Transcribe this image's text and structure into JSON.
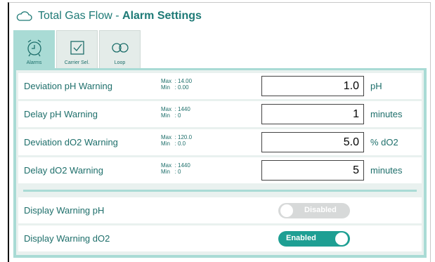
{
  "header": {
    "title_prefix": "Total Gas Flow - ",
    "title_bold": "Alarm Settings",
    "icon": "cloud-icon"
  },
  "tabs": [
    {
      "label": "Alarms",
      "icon": "alarm-clock-icon",
      "active": true
    },
    {
      "label": "Carrier Sel.",
      "icon": "checkbox-icon",
      "active": false
    },
    {
      "label": "Loop",
      "icon": "loop-icon",
      "active": false
    }
  ],
  "settings": [
    {
      "label": "Deviation pH Warning",
      "max_label": "Max",
      "max": ": 14.00",
      "min_label": "Min",
      "min": ": 0.00",
      "value": "1.0",
      "unit": "pH"
    },
    {
      "label": "Delay pH Warning",
      "max_label": "Max",
      "max": ": 1440",
      "min_label": "Min",
      "min": ": 0",
      "value": "1",
      "unit": "minutes"
    },
    {
      "label": "Deviation dO2 Warning",
      "max_label": "Max",
      "max": ": 120.0",
      "min_label": "Min",
      "min": ": 0.0",
      "value": "5.0",
      "unit": "% dO2"
    },
    {
      "label": "Delay dO2 Warning",
      "max_label": "Max",
      "max": ": 1440",
      "min_label": "Min",
      "min": ": 0",
      "value": "5",
      "unit": "minutes"
    }
  ],
  "toggles": [
    {
      "label": "Display Warning pH",
      "state_label": "Disabled",
      "enabled": false
    },
    {
      "label": "Display Warning dO2",
      "state_label": "Enabled",
      "enabled": true
    }
  ],
  "colors": {
    "accent": "#1e7a76",
    "panel": "#a9dbd5",
    "toggle_on": "#1e9f93",
    "toggle_off": "#d7d9d9"
  }
}
